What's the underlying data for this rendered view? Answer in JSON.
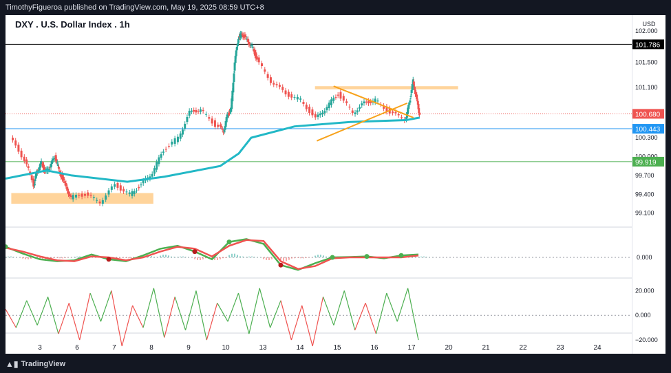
{
  "header": {
    "publisher_line": "TimothyFigueroa published on TradingView.com, May 19, 2025 08:59 UTC+8"
  },
  "chart_title": "DXY . U.S. Dollar Index . 1h",
  "currency": "USD",
  "footer": {
    "brand": "TradingView"
  },
  "colors": {
    "bull": "#26a69a",
    "bear": "#ef5350",
    "ema": "#22b8c6",
    "zone": "#ffcc8a",
    "triangle": "#f7a21b"
  },
  "chart_data": [
    {
      "type": "candlestick",
      "title": "DXY . U.S. Dollar Index . 1h",
      "x_ticks": [
        "3",
        "6",
        "7",
        "8",
        "9",
        "10",
        "13",
        "14",
        "15",
        "16",
        "17",
        "20",
        "21",
        "22",
        "23",
        "24"
      ],
      "y_ticks": [
        "102.000",
        "101.500",
        "101.100",
        "100.300",
        "100.000",
        "99.700",
        "99.400",
        "99.100"
      ],
      "ylim": [
        98.9,
        102.25
      ],
      "price_labels": [
        {
          "label": "101.786",
          "value": 101.786,
          "color": "#000000"
        },
        {
          "label": "100.680",
          "value": 100.68,
          "color": "#ef5350"
        },
        {
          "label": "100.443",
          "value": 100.443,
          "color": "#2196f3"
        },
        {
          "label": "99.919",
          "value": 99.919,
          "color": "#4caf50"
        }
      ],
      "horizontal_lines": [
        {
          "value": 101.786,
          "color": "#000000"
        },
        {
          "value": 100.68,
          "color": "#ef5350",
          "style": "dotted"
        },
        {
          "value": 100.443,
          "color": "#2196f3"
        },
        {
          "value": 99.919,
          "color": "#4caf50"
        }
      ],
      "resistance_zones": [
        {
          "from_day": 2.2,
          "to_day": 8.2,
          "low": 99.25,
          "high": 99.42
        },
        {
          "from_day": 14.55,
          "to_day": 20.4,
          "low": 101.07,
          "high": 101.12
        }
      ],
      "price_path": [
        [
          2.2,
          100.3
        ],
        [
          2.7,
          99.95
        ],
        [
          3.0,
          99.55
        ],
        [
          3.2,
          99.75
        ],
        [
          3.6,
          99.9
        ],
        [
          3.9,
          99.75
        ],
        [
          4.3,
          99.85
        ],
        [
          4.7,
          100.0
        ],
        [
          5.0,
          99.8
        ],
        [
          5.5,
          99.55
        ],
        [
          6.0,
          99.35
        ],
        [
          6.4,
          99.4
        ],
        [
          6.8,
          99.28
        ],
        [
          7.2,
          99.55
        ],
        [
          7.6,
          99.4
        ],
        [
          7.9,
          99.55
        ],
        [
          8.2,
          99.75
        ],
        [
          8.5,
          100.1
        ],
        [
          8.9,
          100.3
        ],
        [
          9.2,
          100.7
        ],
        [
          9.5,
          100.75
        ],
        [
          9.9,
          100.5
        ],
        [
          10.3,
          100.4
        ],
        [
          10.6,
          100.65
        ],
        [
          10.9,
          100.75
        ],
        [
          11.2,
          101.5
        ],
        [
          11.5,
          101.9
        ],
        [
          11.8,
          101.95
        ],
        [
          12.2,
          101.85
        ],
        [
          12.6,
          101.75
        ],
        [
          13.0,
          101.55
        ],
        [
          13.4,
          101.2
        ],
        [
          13.8,
          101.0
        ],
        [
          14.2,
          100.9
        ],
        [
          14.6,
          100.6
        ],
        [
          14.9,
          100.8
        ],
        [
          15.2,
          101.0
        ],
        [
          15.6,
          100.7
        ],
        [
          15.9,
          100.85
        ],
        [
          16.2,
          100.9
        ],
        [
          16.6,
          100.7
        ],
        [
          17.0,
          100.6
        ],
        [
          17.3,
          100.85
        ],
        [
          17.6,
          101.2
        ],
        [
          17.9,
          100.9
        ],
        [
          18.1,
          100.68
        ]
      ],
      "ema_path": [
        [
          2.0,
          99.65
        ],
        [
          4.0,
          99.78
        ],
        [
          6.0,
          99.7
        ],
        [
          7.5,
          99.6
        ],
        [
          8.5,
          99.68
        ],
        [
          10.0,
          99.85
        ],
        [
          11.5,
          100.05
        ],
        [
          12.5,
          100.3
        ],
        [
          14.0,
          100.48
        ],
        [
          15.5,
          100.55
        ],
        [
          17.0,
          100.58
        ],
        [
          18.1,
          100.62
        ]
      ],
      "triangle": [
        {
          "from": [
            14.6,
            100.25
          ],
          "to": [
            17.1,
            100.85
          ]
        },
        {
          "from": [
            15.05,
            101.12
          ],
          "to": [
            17.6,
            100.62
          ]
        }
      ]
    },
    {
      "type": "oscillator",
      "y_ticks": [
        "0.000"
      ],
      "series": [
        {
          "color": "#4caf50",
          "values": [
            0.55,
            0.2,
            -0.1,
            -0.2,
            -0.15,
            0.15,
            -0.1,
            -0.2,
            0.1,
            0.45,
            0.6,
            0.3,
            -0.1,
            0.8,
            0.95,
            0.7,
            -0.4,
            -0.65,
            -0.3,
            0.0,
            0.02,
            0.05,
            -0.05,
            0.1,
            0.15
          ]
        },
        {
          "color": "#ef5350",
          "values": [
            0.5,
            0.3,
            0.05,
            -0.15,
            -0.2,
            0.05,
            0.0,
            -0.15,
            0.0,
            0.3,
            0.55,
            0.45,
            0.05,
            0.6,
            0.9,
            0.85,
            -0.2,
            -0.6,
            -0.45,
            -0.05,
            0.0,
            0.0,
            0.0,
            0.0,
            0.1
          ]
        }
      ]
    },
    {
      "type": "line",
      "y_ticks": [
        "20.000",
        "0.000",
        "−20.000"
      ],
      "ylim": [
        -30,
        28
      ],
      "series": [
        {
          "color": "#4caf50",
          "values": [
            5,
            -10,
            12,
            -8,
            15,
            -15,
            10,
            -20,
            18,
            -5,
            20,
            -25,
            8,
            -10,
            22,
            -18,
            15,
            -12,
            20,
            -20,
            10,
            -5,
            18,
            -15,
            22,
            -10,
            12,
            -20,
            8,
            -25,
            15,
            -8,
            20,
            -12,
            10,
            -15,
            18,
            -5,
            22,
            -20
          ]
        }
      ]
    }
  ]
}
